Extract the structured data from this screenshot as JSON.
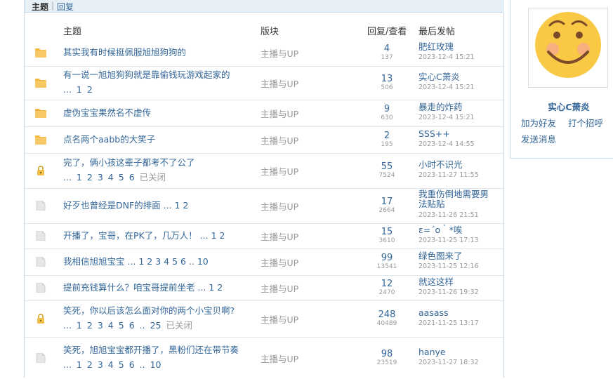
{
  "tabs": {
    "topics": "主题",
    "sep": "|",
    "replies": "回复"
  },
  "columns": {
    "title": "主题",
    "forum": "版块",
    "stats": "回复/查看",
    "last": "最后发帖"
  },
  "threads": [
    {
      "icon": "folder-icon",
      "title": "其实我有时候挺佩服旭旭狗狗的",
      "pages": "",
      "forum": "主播与UP",
      "replies": "4",
      "views": "137",
      "last_user": "肥红玫瑰",
      "last_time": "2023-12-4 15:21"
    },
    {
      "icon": "folder-icon",
      "title": "有一说一旭旭狗狗就是靠偷钱玩游戏起家的",
      "pages": "... 1 2",
      "forum": "主播与UP",
      "replies": "13",
      "views": "506",
      "last_user": "实心C萧炎",
      "last_time": "2023-12-4 15:21"
    },
    {
      "icon": "folder-icon",
      "title": "虚伪宝宝果然名不虚传",
      "pages": "",
      "forum": "主播与UP",
      "replies": "9",
      "views": "630",
      "last_user": "暴走的炸药",
      "last_time": "2023-12-4 15:21"
    },
    {
      "icon": "folder-icon",
      "title": "点名两个aabb的大笑子",
      "pages": "",
      "forum": "主播与UP",
      "replies": "2",
      "views": "195",
      "last_user": "SSS++",
      "last_time": "2023-12-4 14:55"
    },
    {
      "icon": "lock-icon",
      "title": "完了，俩小孩这辈子都考不了公了",
      "pages": "... 1 2 3 4 5 6",
      "closed": "已关闭",
      "forum": "主播与UP",
      "replies": "55",
      "views": "7524",
      "last_user": "小时不识光",
      "last_time": "2023-11-27 11:55"
    },
    {
      "icon": "doc-icon",
      "title": "好歹也曾经是DNF的排面 ... 1 2",
      "pages": "",
      "forum": "主播与UP",
      "replies": "17",
      "views": "2664",
      "last_user": "我重伤倒地需要男法贴贴",
      "last_time": "2023-11-26 21:51"
    },
    {
      "icon": "doc-icon",
      "title": "开播了，宝哥，在PK了，几万人！ ... 1 2",
      "pages": "",
      "forum": "主播与UP",
      "replies": "15",
      "views": "3610",
      "last_user": "ε=´o｀*唉",
      "last_time": "2023-11-25 17:13"
    },
    {
      "icon": "doc-icon",
      "title": "我相信旭旭宝宝 ... 1 2 3 4 5 6 .. 10",
      "pages": "",
      "forum": "主播与UP",
      "replies": "99",
      "views": "13541",
      "last_user": "绿色图来了",
      "last_time": "2023-11-25 12:16"
    },
    {
      "icon": "doc-icon",
      "title": "提前充钱算什么？咱宝哥提前坐老 ... 1 2",
      "pages": "",
      "forum": "主播与UP",
      "replies": "12",
      "views": "2470",
      "last_user": "就这这样",
      "last_time": "2023-11-26 19:32"
    },
    {
      "icon": "lock-icon",
      "title": "笑死，你以后该怎么面对你的两个小宝贝啊?",
      "pages": "... 1 2 3 4 5 6 .. 25",
      "closed": "已关闭",
      "forum": "主播与UP",
      "replies": "248",
      "views": "40489",
      "last_user": "aasass",
      "last_time": "2021-11-25 13:17"
    },
    {
      "icon": "doc-icon",
      "title": "笑死，旭旭宝宝都开播了，黑粉们还在带节奏",
      "pages": "... 1 2 3 4 5 6 .. 10",
      "forum": "主播与UP",
      "replies": "98",
      "views": "23519",
      "last_user": "hanye",
      "last_time": "2023-11-27 18:32"
    }
  ],
  "profile": {
    "name": "实心C萧炎",
    "add_friend": "加为好友",
    "greet": "打个招呼",
    "message": "发送消息",
    "avatar_icon": "smiley-avatar"
  },
  "colors": {
    "link": "#336699",
    "muted": "#999999",
    "folder": "#f5b942",
    "border": "#c7d8e8"
  }
}
